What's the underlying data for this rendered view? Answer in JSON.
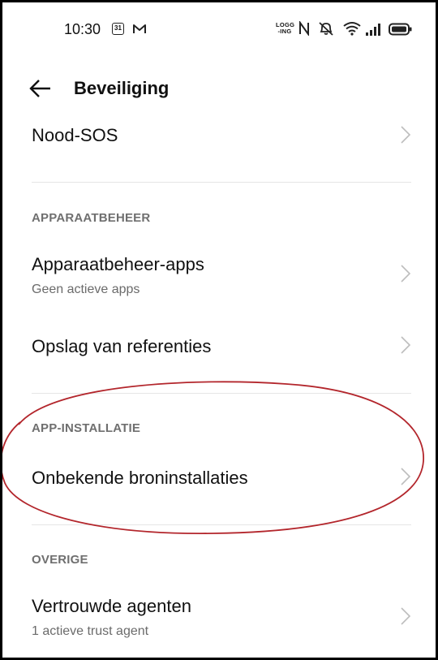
{
  "status_bar": {
    "time": "10:30",
    "calendar_day": "31",
    "logging_label": "LOGG -ING",
    "icons": [
      "calendar-icon",
      "gmail-icon",
      "logging-icon",
      "nfc-icon",
      "mute-icon",
      "wifi-icon",
      "signal-icon",
      "battery-icon"
    ]
  },
  "header": {
    "title": "Beveiliging"
  },
  "items": {
    "nood_sos": {
      "title": "Nood-SOS"
    },
    "section_apparaatbeheer": "APPARAATBEHEER",
    "apparaatbeheer_apps": {
      "title": "Apparaatbeheer-apps",
      "subtitle": "Geen actieve apps"
    },
    "opslag_referenties": {
      "title": "Opslag van referenties"
    },
    "section_app_installatie": "APP-INSTALLATIE",
    "onbekende_bron": {
      "title": "Onbekende broninstallaties"
    },
    "section_overige": "OVERIGE",
    "vertrouwde_agenten": {
      "title": "Vertrouwde agenten",
      "subtitle": "1 actieve trust agent"
    }
  },
  "colors": {
    "annotation_ellipse": "#b3262c",
    "chevron": "#bdbdbd",
    "section_header": "#6f6f6f",
    "subtitle": "#6b6b6b"
  }
}
